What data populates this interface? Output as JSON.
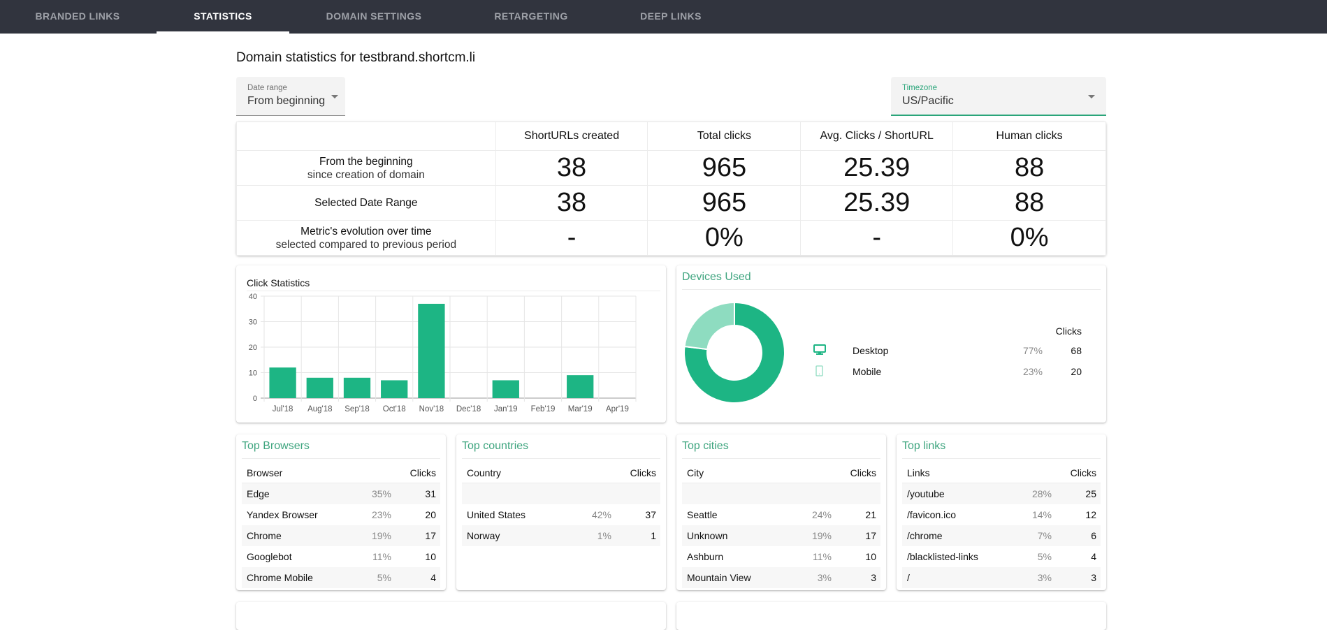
{
  "nav": {
    "tabs": [
      {
        "label": "BRANDED LINKS",
        "active": false
      },
      {
        "label": "STATISTICS",
        "active": true
      },
      {
        "label": "DOMAIN SETTINGS",
        "active": false
      },
      {
        "label": "RETARGETING",
        "active": false
      },
      {
        "label": "DEEP LINKS",
        "active": false
      }
    ]
  },
  "page": {
    "title": "Domain statistics for testbrand.shortcm.li"
  },
  "filters": {
    "date_range": {
      "label": "Date range",
      "value": "From beginning"
    },
    "timezone": {
      "label": "Timezone",
      "value": "US/Pacific"
    }
  },
  "summary": {
    "columns": [
      "",
      "ShortURLs created",
      "Total clicks",
      "Avg. Clicks / ShortURL",
      "Human clicks"
    ],
    "rows": [
      {
        "label": "From the beginning",
        "sublabel": "since creation of domain",
        "values": [
          "38",
          "965",
          "25.39",
          "88"
        ]
      },
      {
        "label": "Selected Date Range",
        "sublabel": "",
        "values": [
          "38",
          "965",
          "25.39",
          "88"
        ]
      },
      {
        "label": "Metric's evolution over time",
        "sublabel": "selected compared to previous period",
        "values": [
          "-",
          "0%",
          "-",
          "0%"
        ]
      }
    ]
  },
  "click_statistics": {
    "title": "Click Statistics"
  },
  "chart_data": {
    "type": "bar",
    "title": "Click Statistics",
    "xlabel": "",
    "ylabel": "",
    "categories": [
      "Jul'18",
      "Aug'18",
      "Sep'18",
      "Oct'18",
      "Nov'18",
      "Dec'18",
      "Jan'19",
      "Feb'19",
      "Mar'19",
      "Apr'19"
    ],
    "values": [
      12,
      8,
      8,
      7,
      37,
      0,
      7,
      0,
      9,
      0
    ],
    "ylim": [
      0,
      40
    ],
    "yticks": [
      0,
      10,
      20,
      30,
      40
    ],
    "grid": true,
    "bar_color": "#1db584"
  },
  "devices": {
    "title": "Devices Used",
    "clicks_header": "Clicks",
    "items": [
      {
        "icon": "desktop-icon",
        "name": "Desktop",
        "pct": "77%",
        "clicks": "68",
        "share": 0.77,
        "color": "#1db584"
      },
      {
        "icon": "mobile-icon",
        "name": "Mobile",
        "pct": "23%",
        "clicks": "20",
        "share": 0.23,
        "color": "#8edcc0"
      }
    ]
  },
  "top_browsers": {
    "title": "Top Browsers",
    "col_a": "Browser",
    "col_b": "Clicks",
    "rows": [
      {
        "name": "Edge",
        "pct": "35%",
        "clicks": "31"
      },
      {
        "name": "Yandex Browser",
        "pct": "23%",
        "clicks": "20"
      },
      {
        "name": "Chrome",
        "pct": "19%",
        "clicks": "17"
      },
      {
        "name": "Googlebot",
        "pct": "11%",
        "clicks": "10"
      },
      {
        "name": "Chrome Mobile",
        "pct": "5%",
        "clicks": "4"
      }
    ]
  },
  "top_countries": {
    "title": "Top countries",
    "col_a": "Country",
    "col_b": "Clicks",
    "rows": [
      {
        "name": "",
        "pct": "",
        "clicks": ""
      },
      {
        "name": "United States",
        "pct": "42%",
        "clicks": "37"
      },
      {
        "name": "Norway",
        "pct": "1%",
        "clicks": "1"
      }
    ]
  },
  "top_cities": {
    "title": "Top cities",
    "col_a": "City",
    "col_b": "Clicks",
    "rows": [
      {
        "name": "",
        "pct": "",
        "clicks": ""
      },
      {
        "name": "Seattle",
        "pct": "24%",
        "clicks": "21"
      },
      {
        "name": "Unknown",
        "pct": "19%",
        "clicks": "17"
      },
      {
        "name": "Ashburn",
        "pct": "11%",
        "clicks": "10"
      },
      {
        "name": "Mountain View",
        "pct": "3%",
        "clicks": "3"
      }
    ]
  },
  "top_links": {
    "title": "Top links",
    "col_a": "Links",
    "col_b": "Clicks",
    "rows": [
      {
        "name": "/youtube",
        "pct": "28%",
        "clicks": "25"
      },
      {
        "name": "/favicon.ico",
        "pct": "14%",
        "clicks": "12"
      },
      {
        "name": "/chrome",
        "pct": "7%",
        "clicks": "6"
      },
      {
        "name": "/blacklisted-links",
        "pct": "5%",
        "clicks": "4"
      },
      {
        "name": "/",
        "pct": "3%",
        "clicks": "3"
      }
    ]
  }
}
